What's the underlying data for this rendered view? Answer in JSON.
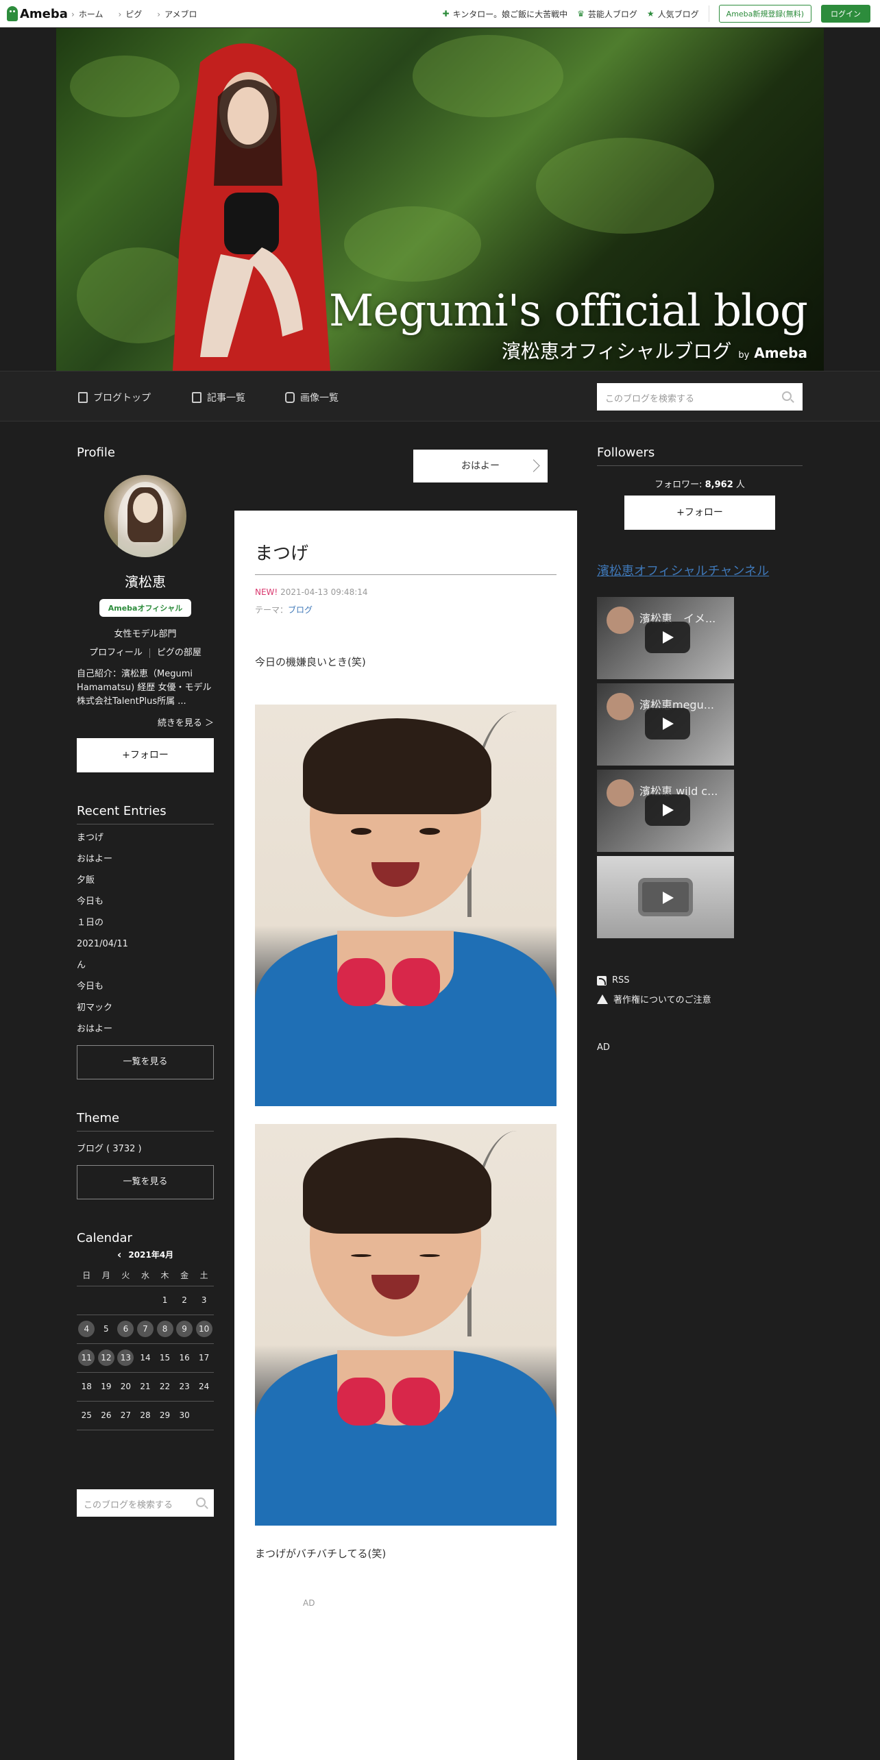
{
  "topbar": {
    "logo": "Ameba",
    "nav": [
      "ホーム",
      "ピグ",
      "アメブロ"
    ],
    "right_links": [
      "キンタロー。娘ご飯に大苦戦中",
      "芸能人ブログ",
      "人気ブログ"
    ],
    "register": "Ameba新規登録(無料)",
    "login": "ログイン"
  },
  "hero": {
    "title": "Megumi's official blog",
    "subtitle": "濱松恵オフィシャルブログ",
    "by_prefix": "by",
    "by_brand": "Ameba"
  },
  "subnav": {
    "items": [
      "ブログトップ",
      "記事一覧",
      "画像一覧"
    ],
    "search_placeholder": "このブログを検索する"
  },
  "profile": {
    "heading": "Profile",
    "name": "濱松恵",
    "badge": "Amebaオフィシャル",
    "category": "女性モデル部門",
    "link_profile": "プロフィール",
    "link_pig": "ピグの部屋",
    "intro": "自己紹介：濱松恵（Megumi Hamamatsu) 経歴 女優・モデル 株式会社TalentPlus所属 ...",
    "more": "続きを見る ＞",
    "follow": "+フォロー"
  },
  "recent": {
    "heading": "Recent Entries",
    "items": [
      "まつげ",
      "おはよー",
      "夕飯",
      "今日も",
      "１日の",
      "2021/04/11",
      "ん",
      "今日も",
      "初マック",
      "おはよー"
    ],
    "see_all": "一覧を見る"
  },
  "theme": {
    "heading": "Theme",
    "item": "ブログ ( 3732 )",
    "see_all": "一覧を見る"
  },
  "calendar": {
    "heading": "Calendar",
    "month": "2021年4月",
    "weekdays": [
      "日",
      "月",
      "火",
      "水",
      "木",
      "金",
      "土"
    ],
    "weeks": [
      [
        "",
        "",
        "",
        "",
        "1",
        "2",
        "3"
      ],
      [
        "4",
        "5",
        "6",
        "7",
        "8",
        "9",
        "10"
      ],
      [
        "11",
        "12",
        "13",
        "14",
        "15",
        "16",
        "17"
      ],
      [
        "18",
        "19",
        "20",
        "21",
        "22",
        "23",
        "24"
      ],
      [
        "25",
        "26",
        "27",
        "28",
        "29",
        "30",
        ""
      ]
    ],
    "highlighted": [
      "4",
      "6",
      "7",
      "8",
      "9",
      "10",
      "11",
      "12",
      "13"
    ]
  },
  "left_search_placeholder": "このブログを検索する",
  "prev_button": "おはよー",
  "article": {
    "title": "まつげ",
    "new_label": "NEW!",
    "date": "2021-04-13 09:48:14",
    "theme_label": "テーマ：",
    "theme_value": "ブログ",
    "text1": "今日の機嫌良いとき(笑)",
    "text2": "まつげがバチバチしてる(笑)",
    "ad": "AD"
  },
  "followers": {
    "heading": "Followers",
    "label": "フォロワー: ",
    "count": "8,962",
    "unit": " 人",
    "follow": "+フォロー"
  },
  "channel": {
    "title": "濱松恵オフィシャルチャンネル",
    "videos": [
      "濱松恵　イメ...",
      "濱松恵megu...",
      "濱松恵 wild c..."
    ]
  },
  "links": {
    "rss": "RSS",
    "copyright": "著作権についてのご注意",
    "ad": "AD"
  }
}
